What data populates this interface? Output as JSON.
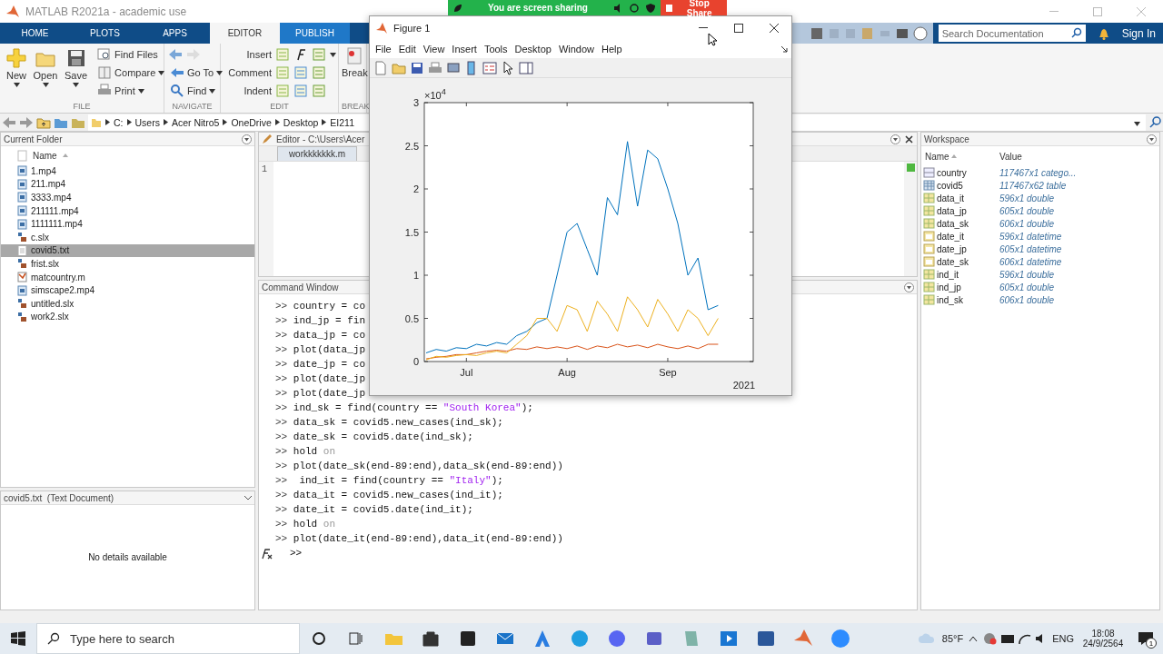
{
  "app_window": {
    "title": "MATLAB R2021a - academic use"
  },
  "screen_share": {
    "message": "You are screen sharing",
    "button": "Stop Share"
  },
  "ribbon_tabs": [
    {
      "label": "HOME",
      "kind": "main",
      "selected": false
    },
    {
      "label": "PLOTS",
      "kind": "main",
      "selected": false
    },
    {
      "label": "APPS",
      "kind": "main",
      "selected": false
    },
    {
      "label": "EDITOR",
      "kind": "context",
      "selected": true
    },
    {
      "label": "PUBLISH",
      "kind": "context",
      "selected": false
    }
  ],
  "search": {
    "placeholder": "Search Documentation"
  },
  "sign_in": "Sign In",
  "ribbon_groups": [
    {
      "label": "FILE",
      "items": [
        {
          "kind": "large",
          "label": "New",
          "menu": true
        },
        {
          "kind": "large",
          "label": "Open",
          "menu": true
        },
        {
          "kind": "large",
          "label": "Save",
          "menu": true
        },
        {
          "kind": "small",
          "label": "Find Files",
          "menu": false
        },
        {
          "kind": "small",
          "label": "Compare",
          "menu": true
        },
        {
          "kind": "small",
          "label": "Print",
          "menu": true
        }
      ]
    },
    {
      "label": "NAVIGATE",
      "items": [
        {
          "kind": "arrows"
        },
        {
          "kind": "small",
          "label": "Go To",
          "menu": true
        },
        {
          "kind": "small",
          "label": "Find",
          "menu": true
        }
      ]
    },
    {
      "label": "EDIT",
      "items": [
        {
          "kind": "row",
          "label": "Insert",
          "menu": true
        },
        {
          "kind": "row",
          "label": "Comment",
          "menu": false
        },
        {
          "kind": "row",
          "label": "Indent",
          "menu": false
        }
      ]
    },
    {
      "label": "BREAK",
      "items": [
        {
          "kind": "large",
          "label": "Break",
          "menu": false
        }
      ]
    }
  ],
  "path": [
    "C:",
    "Users",
    "Acer Nitro5",
    "OneDrive",
    "Desktop",
    "EI211"
  ],
  "current_folder": {
    "title": "Current Folder",
    "column": "Name",
    "files": [
      {
        "name": "1.mp4",
        "kind": "video",
        "selected": false
      },
      {
        "name": "211.mp4",
        "kind": "video",
        "selected": false
      },
      {
        "name": "3333.mp4",
        "kind": "video",
        "selected": false
      },
      {
        "name": "211111.mp4",
        "kind": "video",
        "selected": false
      },
      {
        "name": "1111111.mp4",
        "kind": "video",
        "selected": false
      },
      {
        "name": "c.slx",
        "kind": "model",
        "selected": false
      },
      {
        "name": "covid5.txt",
        "kind": "text",
        "selected": true
      },
      {
        "name": "frist.slx",
        "kind": "model",
        "selected": false
      },
      {
        "name": "matcountry.m",
        "kind": "script",
        "selected": false
      },
      {
        "name": "simscape2.mp4",
        "kind": "video",
        "selected": false
      },
      {
        "name": "untitled.slx",
        "kind": "model",
        "selected": false
      },
      {
        "name": "work2.slx",
        "kind": "model",
        "selected": false
      }
    ]
  },
  "details": {
    "title": "covid5.txt  (Text Document)",
    "message": "No details available"
  },
  "editor": {
    "title": "Editor - C:\\Users\\Acer",
    "tabs": [
      {
        "label": "workkkkkkk.m",
        "selected": true
      }
    ],
    "line_numbers": [
      "1"
    ]
  },
  "command_window": {
    "title": "Command Window",
    "lines": [
      {
        "segments": [
          {
            "kind": "prompt",
            "text": ">>"
          },
          {
            "kind": "code",
            "text": " country = co"
          }
        ]
      },
      {
        "segments": [
          {
            "kind": "prompt",
            "text": ">>"
          },
          {
            "kind": "code",
            "text": " ind_jp = fin"
          }
        ]
      },
      {
        "segments": [
          {
            "kind": "prompt",
            "text": ">>"
          },
          {
            "kind": "code",
            "text": " data_jp = co"
          }
        ]
      },
      {
        "segments": [
          {
            "kind": "prompt",
            "text": ">>"
          },
          {
            "kind": "code",
            "text": " plot(data_jp"
          }
        ]
      },
      {
        "segments": [
          {
            "kind": "prompt",
            "text": ">>"
          },
          {
            "kind": "code",
            "text": " date_jp = co"
          }
        ]
      },
      {
        "segments": [
          {
            "kind": "prompt",
            "text": ">>"
          },
          {
            "kind": "code",
            "text": " plot(date_jp"
          }
        ]
      },
      {
        "segments": [
          {
            "kind": "prompt",
            "text": ">>"
          },
          {
            "kind": "code",
            "text": " plot(date_jp"
          }
        ]
      },
      {
        "segments": [
          {
            "kind": "prompt",
            "text": ">>"
          },
          {
            "kind": "code",
            "text": " ind_sk = find(country == "
          },
          {
            "kind": "string",
            "text": "\"South Korea\""
          },
          {
            "kind": "code",
            "text": ");"
          }
        ]
      },
      {
        "segments": [
          {
            "kind": "prompt",
            "text": ">>"
          },
          {
            "kind": "code",
            "text": " data_sk = covid5.new_cases(ind_sk);"
          }
        ]
      },
      {
        "segments": [
          {
            "kind": "prompt",
            "text": ">>"
          },
          {
            "kind": "code",
            "text": " date_sk = covid5.date(ind_sk);"
          }
        ]
      },
      {
        "segments": [
          {
            "kind": "prompt",
            "text": ">>"
          },
          {
            "kind": "code",
            "text": " hold "
          },
          {
            "kind": "keyword",
            "text": "on"
          }
        ]
      },
      {
        "segments": [
          {
            "kind": "prompt",
            "text": ">>"
          },
          {
            "kind": "code",
            "text": " plot(date_sk(end-89:end),data_sk(end-89:end))"
          }
        ]
      },
      {
        "segments": [
          {
            "kind": "prompt",
            "text": ">>"
          },
          {
            "kind": "code",
            "text": "  ind_it = find(country == "
          },
          {
            "kind": "string",
            "text": "\"Italy\""
          },
          {
            "kind": "code",
            "text": ");"
          }
        ]
      },
      {
        "segments": [
          {
            "kind": "prompt",
            "text": ">>"
          },
          {
            "kind": "code",
            "text": " data_it = covid5.new_cases(ind_it);"
          }
        ]
      },
      {
        "segments": [
          {
            "kind": "prompt",
            "text": ">>"
          },
          {
            "kind": "code",
            "text": " date_it = covid5.date(ind_it);"
          }
        ]
      },
      {
        "segments": [
          {
            "kind": "prompt",
            "text": ">>"
          },
          {
            "kind": "code",
            "text": " hold "
          },
          {
            "kind": "keyword",
            "text": "on"
          }
        ]
      },
      {
        "segments": [
          {
            "kind": "prompt",
            "text": ">>"
          },
          {
            "kind": "code",
            "text": " plot(date_it(end-89:end),data_it(end-89:end))"
          }
        ]
      }
    ],
    "prompt": ">>"
  },
  "workspace": {
    "title": "Workspace",
    "columns": [
      "Name",
      "Value"
    ],
    "variables": [
      {
        "name": "country",
        "value": "117467x1 catego...",
        "kind": "categorical"
      },
      {
        "name": "covid5",
        "value": "117467x62 table",
        "kind": "table"
      },
      {
        "name": "data_it",
        "value": "596x1 double",
        "kind": "double"
      },
      {
        "name": "data_jp",
        "value": "605x1 double",
        "kind": "double"
      },
      {
        "name": "data_sk",
        "value": "606x1 double",
        "kind": "double"
      },
      {
        "name": "date_it",
        "value": "596x1 datetime",
        "kind": "datetime"
      },
      {
        "name": "date_jp",
        "value": "605x1 datetime",
        "kind": "datetime"
      },
      {
        "name": "date_sk",
        "value": "606x1 datetime",
        "kind": "datetime"
      },
      {
        "name": "ind_it",
        "value": "596x1 double",
        "kind": "double"
      },
      {
        "name": "ind_jp",
        "value": "605x1 double",
        "kind": "double"
      },
      {
        "name": "ind_sk",
        "value": "606x1 double",
        "kind": "double"
      }
    ]
  },
  "figure": {
    "title": "Figure 1",
    "menu": [
      "File",
      "Edit",
      "View",
      "Insert",
      "Tools",
      "Desktop",
      "Window",
      "Help"
    ],
    "y_exponent": "×10$^{4}$",
    "year_label": "2021",
    "chart_data": {
      "type": "line",
      "categories": [
        null,
        null,
        null,
        null,
        "Jul",
        null,
        null,
        null,
        null,
        null,
        null,
        null,
        null,
        null,
        "Aug",
        null,
        null,
        null,
        null,
        null,
        null,
        null,
        null,
        null,
        "Sep",
        null,
        null,
        null,
        null,
        null
      ],
      "ylim": [
        0,
        3
      ],
      "yticks": [
        0,
        0.5,
        1,
        1.5,
        2,
        2.5,
        3
      ],
      "series": [
        {
          "color": "#0072bd",
          "values": [
            0.1,
            0.14,
            0.12,
            0.16,
            0.15,
            0.2,
            0.18,
            0.22,
            0.2,
            0.3,
            0.35,
            0.45,
            0.5,
            1.0,
            1.5,
            1.6,
            1.3,
            1.0,
            1.9,
            1.7,
            2.55,
            1.8,
            2.45,
            2.35,
            2.0,
            1.6,
            1.0,
            1.2,
            0.6,
            0.65
          ]
        },
        {
          "color": "#d95319",
          "values": [
            0.03,
            0.05,
            0.06,
            0.08,
            0.08,
            0.1,
            0.12,
            0.13,
            0.12,
            0.15,
            0.14,
            0.17,
            0.15,
            0.17,
            0.15,
            0.18,
            0.14,
            0.18,
            0.16,
            0.2,
            0.17,
            0.19,
            0.16,
            0.2,
            0.17,
            0.15,
            0.18,
            0.15,
            0.2,
            0.2
          ]
        },
        {
          "color": "#edb120",
          "values": [
            0.02,
            0.06,
            0.05,
            0.07,
            0.08,
            0.07,
            0.1,
            0.12,
            0.1,
            0.2,
            0.3,
            0.5,
            0.5,
            0.35,
            0.65,
            0.6,
            0.35,
            0.7,
            0.55,
            0.35,
            0.75,
            0.6,
            0.4,
            0.72,
            0.55,
            0.35,
            0.6,
            0.5,
            0.3,
            0.5
          ]
        }
      ]
    }
  },
  "taskbar": {
    "search_placeholder": "Type here to search",
    "weather": "85°F",
    "language": "ENG",
    "time": "18:08",
    "date": "24/9/2564",
    "notifications": "1"
  }
}
